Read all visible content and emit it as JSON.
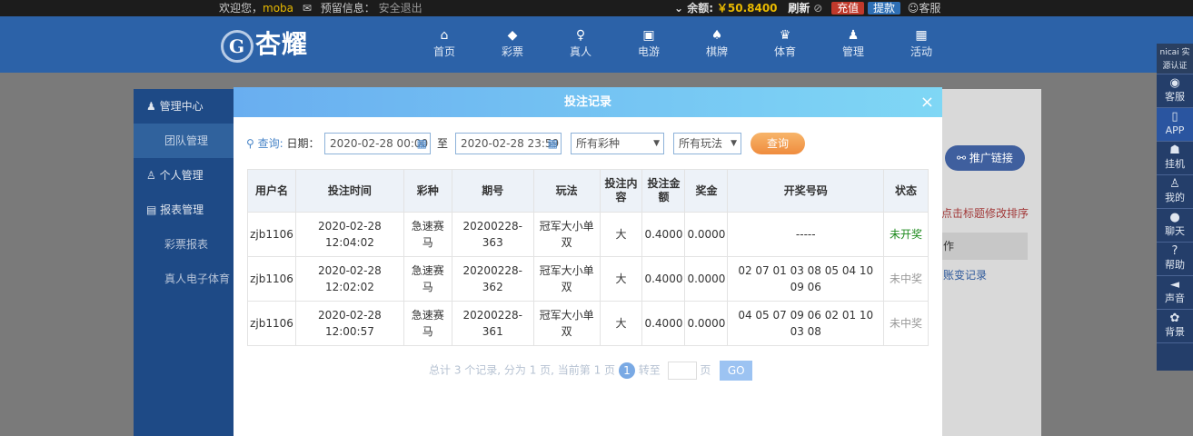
{
  "topbar": {
    "welcome": "欢迎您，",
    "username": "moba",
    "notice": "预留信息：",
    "logout": "安全退出",
    "balance_label": "⌄ 余额:",
    "balance": "￥50.8400",
    "refresh": "刷新",
    "recharge": "充值",
    "withdraw": "提款",
    "service": "客服",
    "colors": {
      "recharge": "#c0392b",
      "withdraw": "#2e6fb5"
    }
  },
  "nav": {
    "logo": "杏耀",
    "items": [
      {
        "label": "首页",
        "icon": "home-icon"
      },
      {
        "label": "彩票",
        "icon": "lottery-icon"
      },
      {
        "label": "真人",
        "icon": "dealer-icon"
      },
      {
        "label": "电游",
        "icon": "slot-icon"
      },
      {
        "label": "棋牌",
        "icon": "cards-icon"
      },
      {
        "label": "体育",
        "icon": "trophy-icon"
      },
      {
        "label": "管理",
        "icon": "users-icon"
      },
      {
        "label": "活动",
        "icon": "gift-icon"
      }
    ]
  },
  "sidebar": {
    "items": [
      {
        "label": "管理中心",
        "icon": "users-icon"
      },
      {
        "label": "团队管理"
      },
      {
        "label": "个人管理",
        "icon": "user-icon"
      },
      {
        "label": "报表管理",
        "icon": "report-icon"
      },
      {
        "label": "彩票报表"
      },
      {
        "label": "真人电子体育"
      }
    ]
  },
  "rightpanel": {
    "promo_button": "推广链接",
    "hint": "点击标题修改排序",
    "col_header": "作",
    "link": "账变记录"
  },
  "floatbar": {
    "top": "nicai 实源认证",
    "items": [
      "客服",
      "APP",
      "挂机",
      "我的",
      "聊天",
      "帮助",
      "声音",
      "背景"
    ]
  },
  "modal": {
    "title": "投注记录",
    "close": "×",
    "query_label": "查询:",
    "date_label": "日期：",
    "start_date": "2020-02-28 00:00",
    "to_label": "至",
    "end_date": "2020-02-28 23:59",
    "lottery_select": "所有彩种",
    "play_select": "所有玩法",
    "query_button": "查询",
    "table": {
      "headers": [
        "用户名",
        "投注时间",
        "彩种",
        "期号",
        "玩法",
        "投注内容",
        "投注金额",
        "奖金",
        "开奖号码",
        "状态"
      ],
      "rows": [
        [
          "zjb1106",
          "2020-02-28 12:04:02",
          "急速赛马",
          "20200228-363",
          "冠军大小单双",
          "大",
          "0.4000",
          "0.0000",
          "-----",
          "未开奖"
        ],
        [
          "zjb1106",
          "2020-02-28 12:02:02",
          "急速赛马",
          "20200228-362",
          "冠军大小单双",
          "大",
          "0.4000",
          "0.0000",
          "02 07 01 03 08 05 04 10 09 06",
          "未中奖"
        ],
        [
          "zjb1106",
          "2020-02-28 12:00:57",
          "急速赛马",
          "20200228-361",
          "冠军大小单双",
          "大",
          "0.4000",
          "0.0000",
          "04 05 07 09 06 02 01 10 03 08",
          "未中奖"
        ]
      ]
    },
    "pager": {
      "summary": "总计 3 个记录, 分为 1 页, 当前第 1 页",
      "current": "1",
      "goto": "转至",
      "page_unit": "页",
      "go": "GO"
    }
  }
}
